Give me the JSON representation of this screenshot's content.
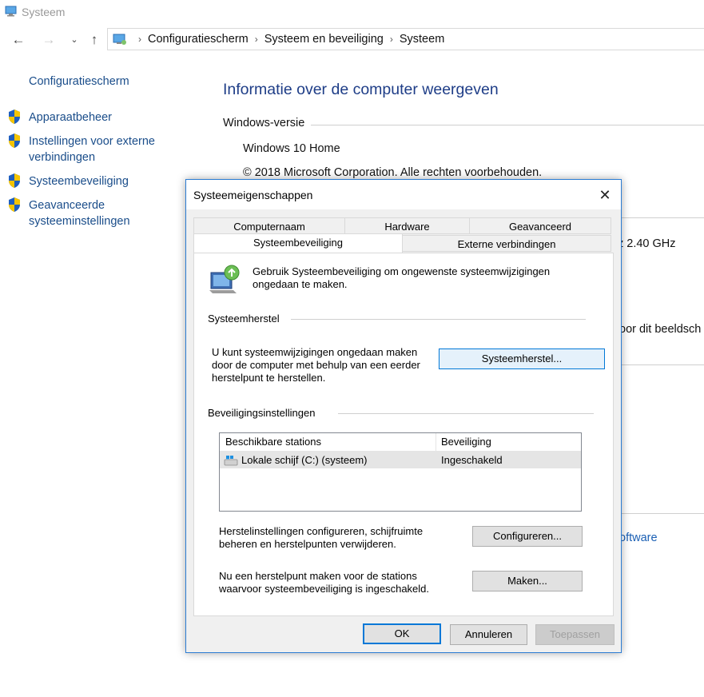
{
  "window": {
    "title": "Systeem"
  },
  "address": {
    "crumbs": [
      "Configuratiescherm",
      "Systeem en beveiliging",
      "Systeem"
    ],
    "separator": "›"
  },
  "sidebar": {
    "home": "Configuratiescherm",
    "items": [
      {
        "label": "Apparaatbeheer",
        "icon": "shield-icon"
      },
      {
        "label": "Instellingen voor externe verbindingen",
        "icon": "shield-icon"
      },
      {
        "label": "Systeembeveiliging",
        "icon": "shield-icon"
      },
      {
        "label": "Geavanceerde systeeminstellingen",
        "icon": "shield-icon"
      }
    ]
  },
  "main": {
    "title": "Informatie over de computer weergeven",
    "windows_section": "Windows-versie",
    "edition": "Windows 10 Home",
    "copyright": "© 2018 Microsoft Corporation. Alle rechten voorbehouden.",
    "partial_ghz": "z  2.40 GHz",
    "partial_display": "oor dit beeldsch",
    "partial_software": "oftware"
  },
  "dialog": {
    "title": "Systeemeigenschappen",
    "close_glyph": "✕",
    "tabs_row1": [
      "Computernaam",
      "Hardware",
      "Geavanceerd"
    ],
    "tabs_row2": [
      "Systeembeveiliging",
      "Externe verbindingen"
    ],
    "active_tab": "Systeembeveiliging",
    "intro": "Gebruik Systeembeveiliging om ongewenste systeemwijzigingen ongedaan te maken.",
    "restore_group": "Systeemherstel",
    "restore_text": "U kunt systeemwijzigingen ongedaan maken door de computer met behulp van een eerder herstelpunt te herstellen.",
    "restore_button": "Systeemherstel...",
    "protection_group": "Beveiligingsinstellingen",
    "columns": [
      "Beschikbare stations",
      "Beveiliging"
    ],
    "rows": [
      {
        "drive": "Lokale schijf (C:) (systeem)",
        "status": "Ingeschakeld"
      }
    ],
    "configure_text": "Herstelinstellingen configureren, schijfruimte beheren en herstelpunten verwijderen.",
    "configure_button": "Configureren...",
    "create_text": "Nu een herstelpunt maken voor de stations waarvoor systeembeveiliging is ingeschakeld.",
    "create_button": "Maken...",
    "ok_button": "OK",
    "cancel_button": "Annuleren",
    "apply_button": "Toepassen"
  },
  "colors": {
    "link": "#1a4d8a",
    "heading": "#1e3d87",
    "accent": "#0078d7"
  }
}
